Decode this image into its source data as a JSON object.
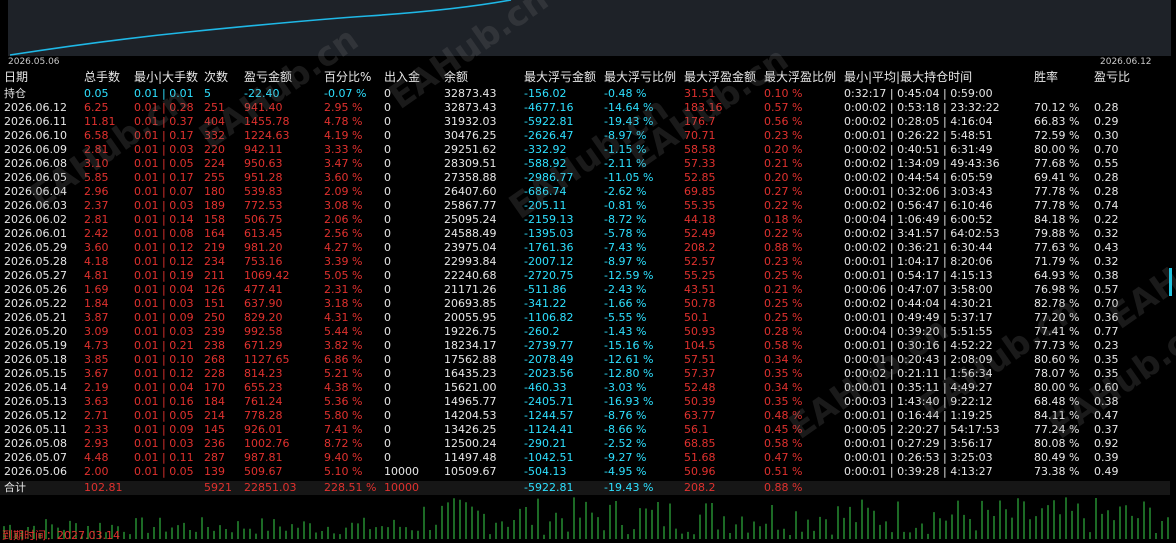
{
  "chart": {
    "start_date": "2026.05.06",
    "end_date": "2026.06.12"
  },
  "watermark": "EAHub.cn",
  "headers": [
    "日期",
    "总手数",
    "最小|大手数",
    "次数",
    "盈亏金额",
    "百分比%",
    "出入金",
    "余额",
    "最大浮亏金额",
    "最大浮亏比例",
    "最大浮盈金额",
    "最大浮盈比例",
    "最小|平均|最大持仓时间",
    "胜率",
    "盈亏比"
  ],
  "position_row": [
    "持仓",
    "0.05",
    "0.01 | 0.01",
    "5",
    "-22.40",
    "-0.07 %",
    "0",
    "32873.43",
    "-156.02",
    "-0.48 %",
    "31.51",
    "0.10 %",
    "0:32:17 | 0:45:04 | 0:59:00",
    "",
    ""
  ],
  "rows": [
    [
      "2026.06.12",
      "6.25",
      "0.01 | 0.28",
      "251",
      "941.40",
      "2.95 %",
      "0",
      "32873.43",
      "-4677.16",
      "-14.64 %",
      "183.16",
      "0.57 %",
      "0:00:02 | 0:53:18 | 23:32:22",
      "70.12 %",
      "0.28"
    ],
    [
      "2026.06.11",
      "11.81",
      "0.01 | 0.37",
      "404",
      "1455.78",
      "4.78 %",
      "0",
      "31932.03",
      "-5922.81",
      "-19.43 %",
      "176.7",
      "0.56 %",
      "0:00:02 | 0:28:05 | 4:16:04",
      "66.83 %",
      "0.29"
    ],
    [
      "2026.06.10",
      "6.58",
      "0.01 | 0.17",
      "332",
      "1224.63",
      "4.19 %",
      "0",
      "30476.25",
      "-2626.47",
      "-8.97 %",
      "70.71",
      "0.23 %",
      "0:00:01 | 0:26:22 | 5:48:51",
      "72.59 %",
      "0.30"
    ],
    [
      "2026.06.09",
      "2.81",
      "0.01 | 0.03",
      "220",
      "942.11",
      "3.33 %",
      "0",
      "29251.62",
      "-332.92",
      "-1.15 %",
      "58.58",
      "0.20 %",
      "0:00:02 | 0:40:51 | 6:31:49",
      "80.00 %",
      "0.70"
    ],
    [
      "2026.06.08",
      "3.10",
      "0.01 | 0.05",
      "224",
      "950.63",
      "3.47 %",
      "0",
      "28309.51",
      "-588.92",
      "-2.11 %",
      "57.33",
      "0.21 %",
      "0:00:02 | 1:34:09 | 49:43:36",
      "77.68 %",
      "0.55"
    ],
    [
      "2026.06.05",
      "5.85",
      "0.01 | 0.17",
      "255",
      "951.28",
      "3.60 %",
      "0",
      "27358.88",
      "-2986.77",
      "-11.05 %",
      "52.85",
      "0.20 %",
      "0:00:02 | 0:44:54 | 6:05:59",
      "69.41 %",
      "0.28"
    ],
    [
      "2026.06.04",
      "2.96",
      "0.01 | 0.07",
      "180",
      "539.83",
      "2.09 %",
      "0",
      "26407.60",
      "-686.74",
      "-2.62 %",
      "69.85",
      "0.27 %",
      "0:00:01 | 0:32:06 | 3:03:43",
      "77.78 %",
      "0.28"
    ],
    [
      "2026.06.03",
      "2.37",
      "0.01 | 0.03",
      "189",
      "772.53",
      "3.08 %",
      "0",
      "25867.77",
      "-205.11",
      "-0.81 %",
      "55.35",
      "0.22 %",
      "0:00:02 | 0:56:47 | 6:10:46",
      "77.78 %",
      "0.74"
    ],
    [
      "2026.06.02",
      "2.81",
      "0.01 | 0.14",
      "158",
      "506.75",
      "2.06 %",
      "0",
      "25095.24",
      "-2159.13",
      "-8.72 %",
      "44.18",
      "0.18 %",
      "0:00:04 | 1:06:49 | 6:00:52",
      "84.18 %",
      "0.22"
    ],
    [
      "2026.06.01",
      "2.42",
      "0.01 | 0.08",
      "164",
      "613.45",
      "2.56 %",
      "0",
      "24588.49",
      "-1395.03",
      "-5.78 %",
      "52.49",
      "0.22 %",
      "0:00:02 | 3:41:57 | 64:02:53",
      "79.88 %",
      "0.32"
    ],
    [
      "2026.05.29",
      "3.60",
      "0.01 | 0.12",
      "219",
      "981.20",
      "4.27 %",
      "0",
      "23975.04",
      "-1761.36",
      "-7.43 %",
      "208.2",
      "0.88 %",
      "0:00:02 | 0:36:21 | 6:30:44",
      "77.63 %",
      "0.43"
    ],
    [
      "2026.05.28",
      "4.18",
      "0.01 | 0.12",
      "234",
      "753.16",
      "3.39 %",
      "0",
      "22993.84",
      "-2007.12",
      "-8.97 %",
      "52.57",
      "0.23 %",
      "0:00:01 | 1:04:17 | 8:20:06",
      "71.79 %",
      "0.32"
    ],
    [
      "2026.05.27",
      "4.81",
      "0.01 | 0.19",
      "211",
      "1069.42",
      "5.05 %",
      "0",
      "22240.68",
      "-2720.75",
      "-12.59 %",
      "55.25",
      "0.25 %",
      "0:00:01 | 0:54:17 | 4:15:13",
      "64.93 %",
      "0.38"
    ],
    [
      "2026.05.26",
      "1.69",
      "0.01 | 0.04",
      "126",
      "477.41",
      "2.31 %",
      "0",
      "21171.26",
      "-511.86",
      "-2.43 %",
      "43.51",
      "0.21 %",
      "0:00:06 | 0:47:07 | 3:58:00",
      "76.98 %",
      "0.57"
    ],
    [
      "2026.05.22",
      "1.84",
      "0.01 | 0.03",
      "151",
      "637.90",
      "3.18 %",
      "0",
      "20693.85",
      "-341.22",
      "-1.66 %",
      "50.78",
      "0.25 %",
      "0:00:02 | 0:44:04 | 4:30:21",
      "82.78 %",
      "0.70"
    ],
    [
      "2026.05.21",
      "3.87",
      "0.01 | 0.09",
      "250",
      "829.20",
      "4.31 %",
      "0",
      "20055.95",
      "-1106.82",
      "-5.55 %",
      "50.1",
      "0.25 %",
      "0:00:01 | 0:49:49 | 5:37:17",
      "77.20 %",
      "0.36"
    ],
    [
      "2026.05.20",
      "3.09",
      "0.01 | 0.03",
      "239",
      "992.58",
      "5.44 %",
      "0",
      "19226.75",
      "-260.2",
      "-1.43 %",
      "50.93",
      "0.28 %",
      "0:00:04 | 0:39:20 | 5:51:55",
      "77.41 %",
      "0.77"
    ],
    [
      "2026.05.19",
      "4.73",
      "0.01 | 0.21",
      "238",
      "671.29",
      "3.82 %",
      "0",
      "18234.17",
      "-2739.77",
      "-15.16 %",
      "104.5",
      "0.58 %",
      "0:00:01 | 0:30:16 | 4:52:22",
      "77.73 %",
      "0.23"
    ],
    [
      "2026.05.18",
      "3.85",
      "0.01 | 0.10",
      "268",
      "1127.65",
      "6.86 %",
      "0",
      "17562.88",
      "-2078.49",
      "-12.61 %",
      "57.51",
      "0.34 %",
      "0:00:01 | 0:20:43 | 2:08:09",
      "80.60 %",
      "0.35"
    ],
    [
      "2026.05.15",
      "3.67",
      "0.01 | 0.12",
      "228",
      "814.23",
      "5.21 %",
      "0",
      "16435.23",
      "-2023.56",
      "-12.80 %",
      "57.37",
      "0.35 %",
      "0:00:02 | 0:21:11 | 1:56:34",
      "78.07 %",
      "0.35"
    ],
    [
      "2026.05.14",
      "2.19",
      "0.01 | 0.04",
      "170",
      "655.23",
      "4.38 %",
      "0",
      "15621.00",
      "-460.33",
      "-3.03 %",
      "52.48",
      "0.34 %",
      "0:00:01 | 0:35:11 | 4:49:27",
      "80.00 %",
      "0.60"
    ],
    [
      "2026.05.13",
      "3.63",
      "0.01 | 0.16",
      "184",
      "761.24",
      "5.36 %",
      "0",
      "14965.77",
      "-2405.71",
      "-16.93 %",
      "50.39",
      "0.35 %",
      "0:00:03 | 1:43:40 | 9:22:12",
      "68.48 %",
      "0.38"
    ],
    [
      "2026.05.12",
      "2.71",
      "0.01 | 0.05",
      "214",
      "778.28",
      "5.80 %",
      "0",
      "14204.53",
      "-1244.57",
      "-8.76 %",
      "63.77",
      "0.48 %",
      "0:00:01 | 0:16:44 | 1:19:25",
      "84.11 %",
      "0.47"
    ],
    [
      "2026.05.11",
      "2.33",
      "0.01 | 0.09",
      "145",
      "926.01",
      "7.41 %",
      "0",
      "13426.25",
      "-1124.41",
      "-8.66 %",
      "56.1",
      "0.45 %",
      "0:00:05 | 2:20:27 | 54:17:53",
      "77.24 %",
      "0.37"
    ],
    [
      "2026.05.08",
      "2.93",
      "0.01 | 0.03",
      "236",
      "1002.76",
      "8.72 %",
      "0",
      "12500.24",
      "-290.21",
      "-2.52 %",
      "68.85",
      "0.58 %",
      "0:00:01 | 0:27:29 | 3:56:17",
      "80.08 %",
      "0.92"
    ],
    [
      "2026.05.07",
      "4.48",
      "0.01 | 0.11",
      "287",
      "987.81",
      "9.40 %",
      "0",
      "11497.48",
      "-1042.51",
      "-9.27 %",
      "51.68",
      "0.47 %",
      "0:00:01 | 0:26:53 | 3:25:03",
      "80.49 %",
      "0.39"
    ],
    [
      "2026.05.06",
      "2.00",
      "0.01 | 0.05",
      "139",
      "509.67",
      "5.10 %",
      "10000",
      "10509.67",
      "-504.13",
      "-4.95 %",
      "50.96",
      "0.51 %",
      "0:00:01 | 0:39:28 | 4:13:27",
      "73.38 %",
      "0.49"
    ]
  ],
  "total_row": [
    "合计",
    "102.81",
    "",
    "5921",
    "22851.03",
    "228.51 %",
    "10000",
    "",
    "-5922.81",
    "-19.43 %",
    "208.2",
    "0.88 %",
    "",
    "",
    ""
  ],
  "footer_text": "到期时间：2027.03.14",
  "colors": {
    "profit": "#e0312e",
    "loss": "#2ee0ff",
    "text": "#e6e6e6",
    "curve": "#1fb8e6",
    "bars": "#39d44a"
  }
}
